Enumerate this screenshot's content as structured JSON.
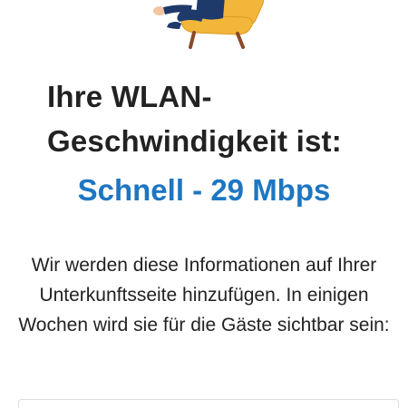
{
  "illustration": {
    "icon": "person-in-armchair-illustration",
    "colors": {
      "chair": "#f2b63a",
      "chair_frame": "#8a4a2a",
      "clothing": "#1e3a6b",
      "skin": "#f3c6a0"
    }
  },
  "title": "Ihre WLAN-Geschwindigkeit ist:",
  "speed_result": "Schnell - 29 Mbps",
  "info_text": "Wir werden diese Informationen auf Ihrer Unterkunftsseite hinzufügen. In einigen Wochen wird sie für die Gäste sichtbar sein:",
  "colors": {
    "accent": "#1d76c2",
    "text": "#222222"
  }
}
